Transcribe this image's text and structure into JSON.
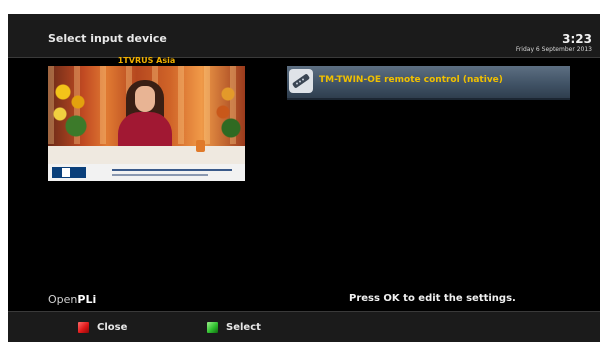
{
  "header": {
    "title": "Select input device",
    "time": "3:23",
    "date": "Friday 6 September 2013"
  },
  "preview": {
    "channel_name": "1TVRUS Asia"
  },
  "device_list": {
    "items": [
      {
        "label": "TM-TWIN-OE remote control (native)",
        "icon": "remote-control-icon",
        "selected": true
      }
    ]
  },
  "brand": {
    "logo_light": "Open",
    "logo_bold": "PLi"
  },
  "hint": "Press OK to edit the settings.",
  "footer": {
    "buttons": [
      {
        "label": "Close",
        "color": "#e01818"
      },
      {
        "label": "Select",
        "color": "#2fbf2f"
      }
    ]
  },
  "colors": {
    "accent": "#f0c000",
    "selection": "#415366"
  }
}
